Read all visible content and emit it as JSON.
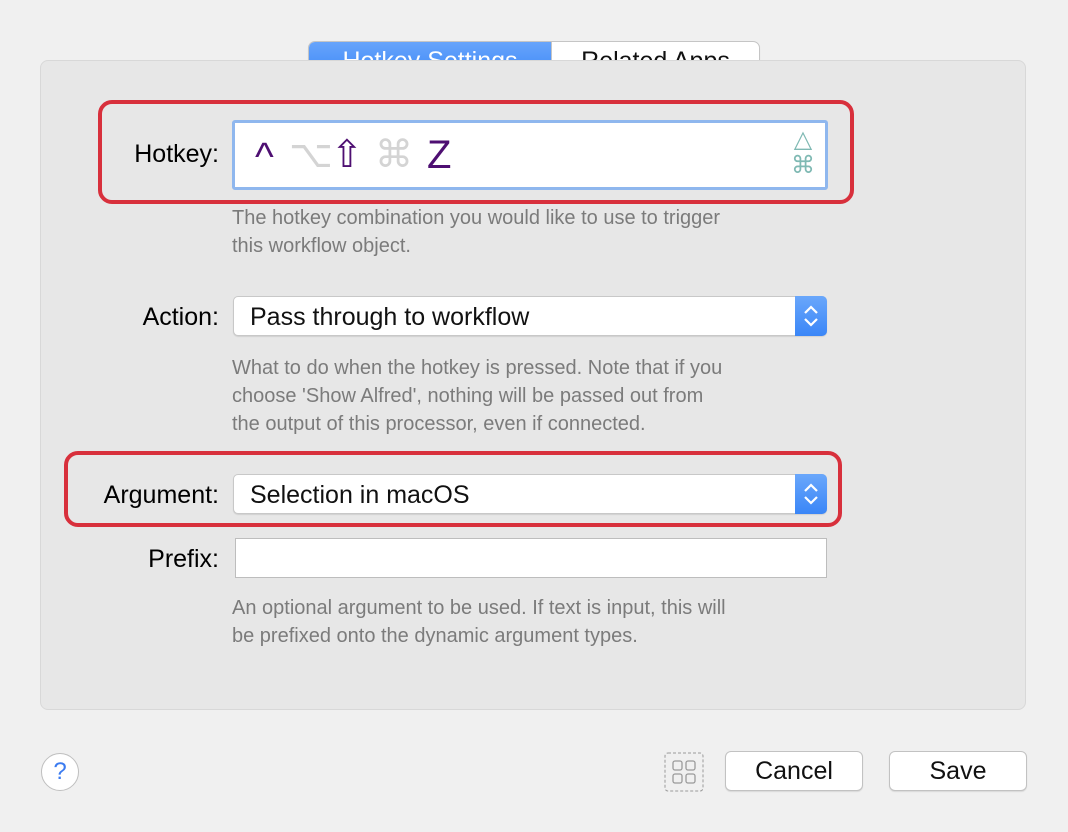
{
  "tabs": [
    {
      "label": "Hotkey Settings",
      "active": true
    },
    {
      "label": "Related Apps",
      "active": false
    }
  ],
  "hotkey": {
    "label": "Hotkey:",
    "modifiers": [
      {
        "symbol": "^",
        "name": "control",
        "active": true
      },
      {
        "symbol": "⌥",
        "name": "option",
        "active": false
      },
      {
        "symbol": "⇧",
        "name": "shift",
        "active": true
      },
      {
        "symbol": "⌘",
        "name": "command",
        "active": false
      }
    ],
    "key": "Z",
    "side_icons": [
      "triangle-icon",
      "command-icon"
    ],
    "side_symbols": [
      "△",
      "⌘"
    ],
    "help_lines": [
      "The hotkey combination you would like to use to trigger",
      "this workflow object."
    ]
  },
  "action": {
    "label": "Action:",
    "value": "Pass through to workflow",
    "help_lines": [
      "What to do when the hotkey is pressed. Note that if you",
      "choose 'Show Alfred', nothing will be passed out from",
      "the output of this processor, even if connected."
    ]
  },
  "argument": {
    "label": "Argument:",
    "value": "Selection in macOS"
  },
  "prefix": {
    "label": "Prefix:",
    "value": "",
    "help_lines": [
      "An optional argument to be used. If text is input, this will",
      "be prefixed onto the dynamic argument types."
    ]
  },
  "footer": {
    "help_symbol": "?",
    "cancel": "Cancel",
    "save": "Save"
  },
  "colors": {
    "accent": "#3a86f7",
    "highlight": "#d8303c",
    "modifier_active": "#4e0f72",
    "modifier_inactive": "#d4d4d4"
  }
}
